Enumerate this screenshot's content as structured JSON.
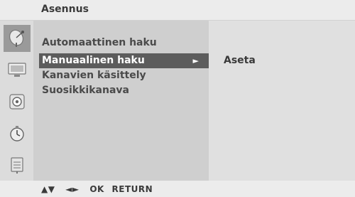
{
  "title": "Asennus",
  "icons": [
    {
      "name": "satellite-dish-icon",
      "selected": true
    },
    {
      "name": "picture-icon",
      "selected": false
    },
    {
      "name": "sound-icon",
      "selected": false
    },
    {
      "name": "clock-icon",
      "selected": false
    },
    {
      "name": "special-icon",
      "selected": false
    }
  ],
  "menu": {
    "items": [
      {
        "label": "Automaattinen haku"
      },
      {
        "label": "Manuaalinen haku",
        "selected": true,
        "arrow": "►"
      },
      {
        "label": "Kanavien käsittely"
      },
      {
        "label": "Suosikkikanava"
      }
    ]
  },
  "submenu": {
    "label": "Aseta"
  },
  "footer": {
    "nav_updown": "▲▼",
    "nav_leftright": "◄►",
    "ok": "OK",
    "return": "RETURN"
  },
  "colors": {
    "background": "#ececec",
    "menu_bg": "#cfcfcf",
    "selected_bg": "#5c5c5c",
    "submenu_bg": "#e0e0e0"
  }
}
